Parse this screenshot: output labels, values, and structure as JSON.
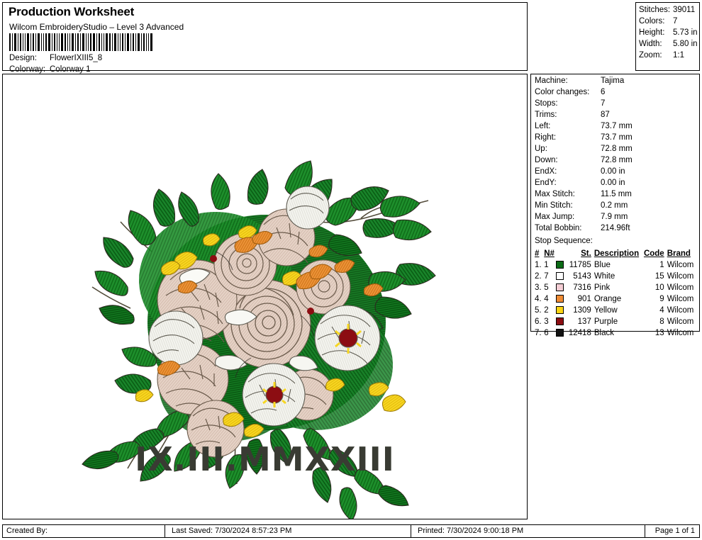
{
  "header": {
    "title": "Production Worksheet",
    "product": "Wilcom EmbroideryStudio – Level 3 Advanced",
    "design_label": "Design:",
    "design_value": "FlowerIXIII5_8",
    "colorway_label": "Colorway:",
    "colorway_value": "Colorway 1",
    "barcode_name": "barcode"
  },
  "stats": [
    {
      "key": "Stitches:",
      "value": "39011"
    },
    {
      "key": "Colors:",
      "value": "7"
    },
    {
      "key": "Height:",
      "value": "5.73 in"
    },
    {
      "key": "Width:",
      "value": "5.80 in"
    },
    {
      "key": "Zoom:",
      "value": "1:1"
    }
  ],
  "info": [
    {
      "key": "Machine:",
      "value": "Tajima"
    },
    {
      "key": "Color changes:",
      "value": "6"
    },
    {
      "key": "Stops:",
      "value": "7"
    },
    {
      "key": "Trims:",
      "value": "87"
    },
    {
      "key": "Left:",
      "value": "73.7 mm"
    },
    {
      "key": "Right:",
      "value": "73.7 mm"
    },
    {
      "key": "Up:",
      "value": "72.8 mm"
    },
    {
      "key": "Down:",
      "value": "72.8 mm"
    },
    {
      "key": "EndX:",
      "value": "0.00 in"
    },
    {
      "key": "EndY:",
      "value": "0.00 in"
    },
    {
      "key": "Max Stitch:",
      "value": "11.5 mm"
    },
    {
      "key": "Min Stitch:",
      "value": "0.2 mm"
    },
    {
      "key": "Max Jump:",
      "value": "7.9 mm"
    },
    {
      "key": "Total Bobbin:",
      "value": "214.96ft"
    }
  ],
  "stop_sequence": {
    "title": "Stop Sequence:",
    "columns": [
      "#",
      "N#",
      "",
      "St.",
      "Description",
      "Code",
      "Brand"
    ],
    "rows": [
      {
        "num": "1.",
        "n": "1",
        "color": "#0b6b16",
        "stitches": "11785",
        "description": "Blue",
        "code": "1",
        "brand": "Wilcom"
      },
      {
        "num": "2.",
        "n": "7",
        "color": "#fdfdfd",
        "stitches": "5143",
        "description": "White",
        "code": "15",
        "brand": "Wilcom"
      },
      {
        "num": "3.",
        "n": "5",
        "color": "#f4cdd4",
        "stitches": "7316",
        "description": "Pink",
        "code": "10",
        "brand": "Wilcom"
      },
      {
        "num": "4.",
        "n": "4",
        "color": "#ef8b34",
        "stitches": "901",
        "description": "Orange",
        "code": "9",
        "brand": "Wilcom"
      },
      {
        "num": "5.",
        "n": "2",
        "color": "#fbd414",
        "stitches": "1309",
        "description": "Yellow",
        "code": "4",
        "brand": "Wilcom"
      },
      {
        "num": "6.",
        "n": "3",
        "color": "#8c0d12",
        "stitches": "137",
        "description": "Purple",
        "code": "8",
        "brand": "Wilcom"
      },
      {
        "num": "7.",
        "n": "6",
        "color": "#121212",
        "stitches": "12418",
        "description": "Black",
        "code": "13",
        "brand": "Wilcom"
      }
    ]
  },
  "design": {
    "roman_numerals": "IX.III.MMXXIII",
    "artwork_name": "floral-bouquet-embroidery",
    "palette": {
      "leaf_green": "#1a8a2a",
      "leaf_green_dark": "#0b6b16",
      "petal_pink": "#e3cfc3",
      "petal_white": "#f2f2ee",
      "yellow": "#f5d415",
      "orange": "#e8912f",
      "purple": "#8c0d12",
      "outline": "#3a2f2a",
      "text_dark": "#393b33"
    }
  },
  "footer": {
    "created_by": "Created By:",
    "last_saved": "Last Saved: 7/30/2024 8:57:23 PM",
    "printed": "Printed: 7/30/2024 9:00:18 PM",
    "page": "Page 1 of 1"
  }
}
